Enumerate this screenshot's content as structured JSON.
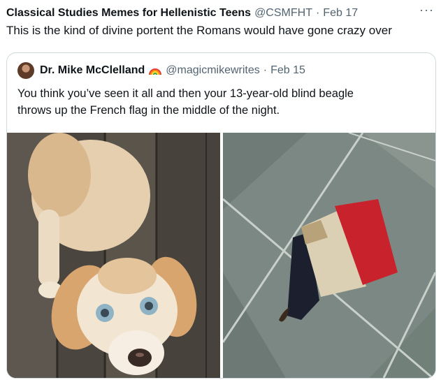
{
  "outer_tweet": {
    "author_name": "Classical Studies Memes for Hellenistic Teens",
    "handle": "@CSMFHT",
    "separator": "·",
    "date": "Feb 17",
    "more_icon": "···",
    "text": "This is the kind of divine portent the Romans would have gone crazy over"
  },
  "quoted_tweet": {
    "author_name": "Dr. Mike McClelland",
    "badge_icon": "rainbow-icon",
    "handle": "@magicmikewrites",
    "separator": "·",
    "date": "Feb 15",
    "text_lines": [
      "You think you’ve seen it all and then your 13-year-old blind beagle",
      "throws up the French flag in the middle of the night."
    ]
  },
  "media": {
    "left_image": "beagle-photo",
    "right_image": "vomit-french-flag-photo"
  },
  "colors": {
    "text": "#0f1419",
    "secondary": "#536471",
    "border": "#cfd9de",
    "flag_blue": "#1b1f2e",
    "flag_white": "#dcd0b4",
    "flag_red": "#c8232c"
  }
}
